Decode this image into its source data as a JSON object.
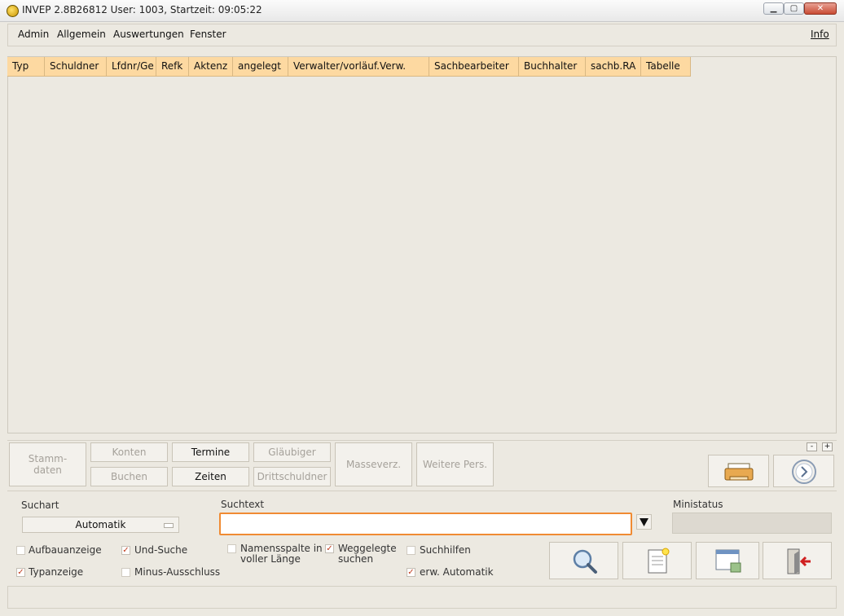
{
  "window": {
    "title": "INVEP 2.8B26812 User: 1003, Startzeit: 09:05:22",
    "min_symbol": "▁",
    "max_symbol": "▢",
    "close_symbol": "✕"
  },
  "menu": {
    "items": [
      "Admin",
      "Allgemein",
      "Auswertungen",
      "Fenster"
    ],
    "info": "Info"
  },
  "table": {
    "columns": [
      "Typ",
      "Schuldner",
      "Lfdnr/Ge",
      "Refk",
      "Aktenz",
      "angelegt",
      "Verwalter/vorläuf.Verw.",
      "Sachbearbeiter",
      "Buchhalter",
      "sachb.RA",
      "Tabelle"
    ],
    "header_color": "#fdd9a1",
    "rows": []
  },
  "buttons": {
    "stammdaten": "Stamm-\ndaten",
    "konten": "Konten",
    "buchen": "Buchen",
    "termine": "Termine",
    "zeiten": "Zeiten",
    "glaeubiger": "Gläubiger",
    "drittschuldner": "Drittschuldner",
    "masseverz": "Masseverz.",
    "weitere_pers": "Weitere Pers.",
    "spin_minus": "-",
    "spin_plus": "+"
  },
  "icons": {
    "print": "printer-icon",
    "next": "clock-arrow-icon",
    "search": "magnifier-icon",
    "new_doc": "new-document-icon",
    "window": "window-icon",
    "exit": "exit-icon"
  },
  "search": {
    "suchart_label": "Suchart",
    "suchart_value": "Automatik",
    "suchtext_label": "Suchtext",
    "suchtext_value": "",
    "ministatus_label": "Ministatus",
    "accent_color": "#f08b33"
  },
  "options": {
    "aufbauanzeige": {
      "label": "Aufbauanzeige",
      "checked": false
    },
    "und_suche": {
      "label": "Und-Suche",
      "checked": true
    },
    "namensspalte": {
      "label": "Namensspalte in\nvoller Länge",
      "checked": false
    },
    "weggelegte": {
      "label": "Weggelegte\nsuchen",
      "checked": true
    },
    "suchhilfen": {
      "label": "Suchhilfen",
      "checked": false
    },
    "typanzeige": {
      "label": "Typanzeige",
      "checked": true
    },
    "minus_ausschluss": {
      "label": "Minus-Ausschluss",
      "checked": false
    },
    "erw_automatik": {
      "label": "erw. Automatik",
      "checked": true
    }
  }
}
